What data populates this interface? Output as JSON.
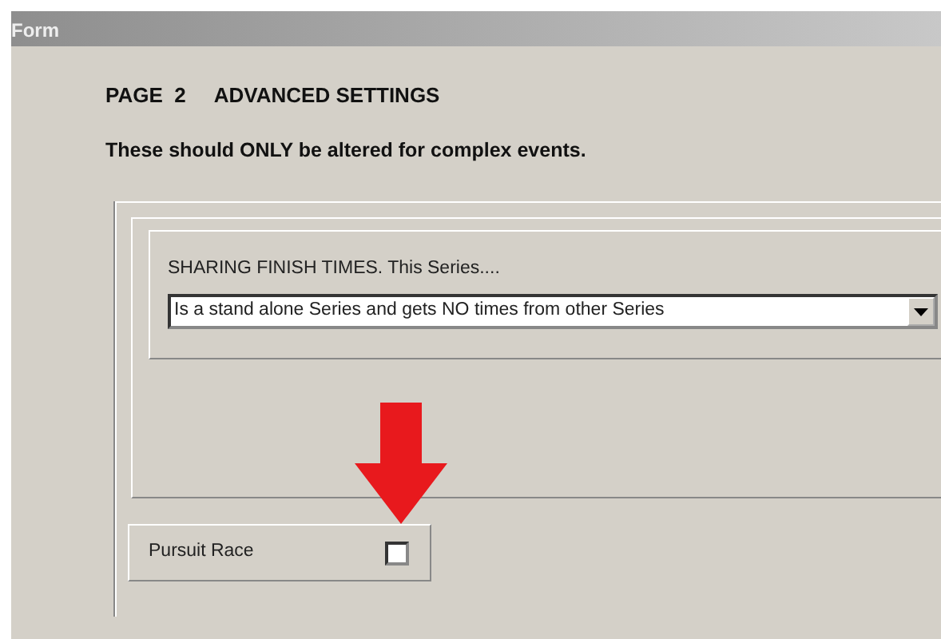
{
  "window": {
    "title": "Form"
  },
  "heading": "PAGE  2     ADVANCED SETTINGS",
  "notice": "These should ONLY be altered for complex events.",
  "sharing": {
    "label": "SHARING FINISH TIMES.  This Series....",
    "value": "Is a stand alone Series and gets NO times from other Series"
  },
  "pursuit": {
    "label": "Pursuit Race",
    "checked": false
  }
}
